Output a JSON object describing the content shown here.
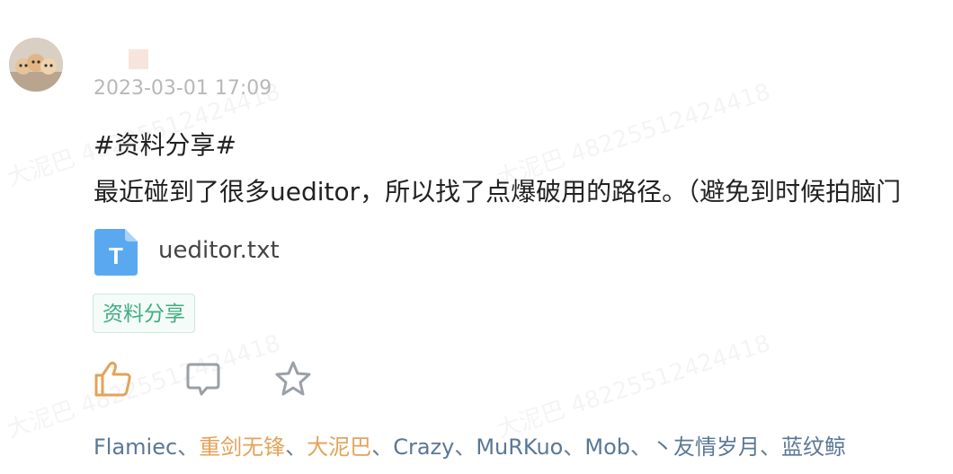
{
  "post": {
    "timestamp": "2023-03-01 17:09",
    "hashtag_line": "#资料分享#",
    "text_line": "最近碰到了很多ueditor，所以找了点爆破用的路径。（避免到时候拍脑门",
    "attachment": {
      "icon_letter": "T",
      "file_name": "ueditor.txt",
      "icon_color": "#5aa9f0"
    },
    "tag": "资料分享"
  },
  "watermark": {
    "name": "大泥巴",
    "id": "48225512424418"
  },
  "actions": {
    "like_icon": "thumbs-up-icon",
    "comment_icon": "comment-icon",
    "favorite_icon": "star-icon"
  },
  "likers": {
    "names": [
      "Flamiec",
      "重剑无锋",
      "大泥巴",
      "Crazy",
      "MuRKuo",
      "Mob",
      "丶友情岁月",
      "蓝纹鲸"
    ],
    "separator": "、",
    "highlighted": [
      "重剑无锋",
      "大泥巴"
    ]
  },
  "colors": {
    "accent_green": "#3fae80",
    "like_orange": "#e3a35a",
    "link_blue": "#5a7896"
  }
}
